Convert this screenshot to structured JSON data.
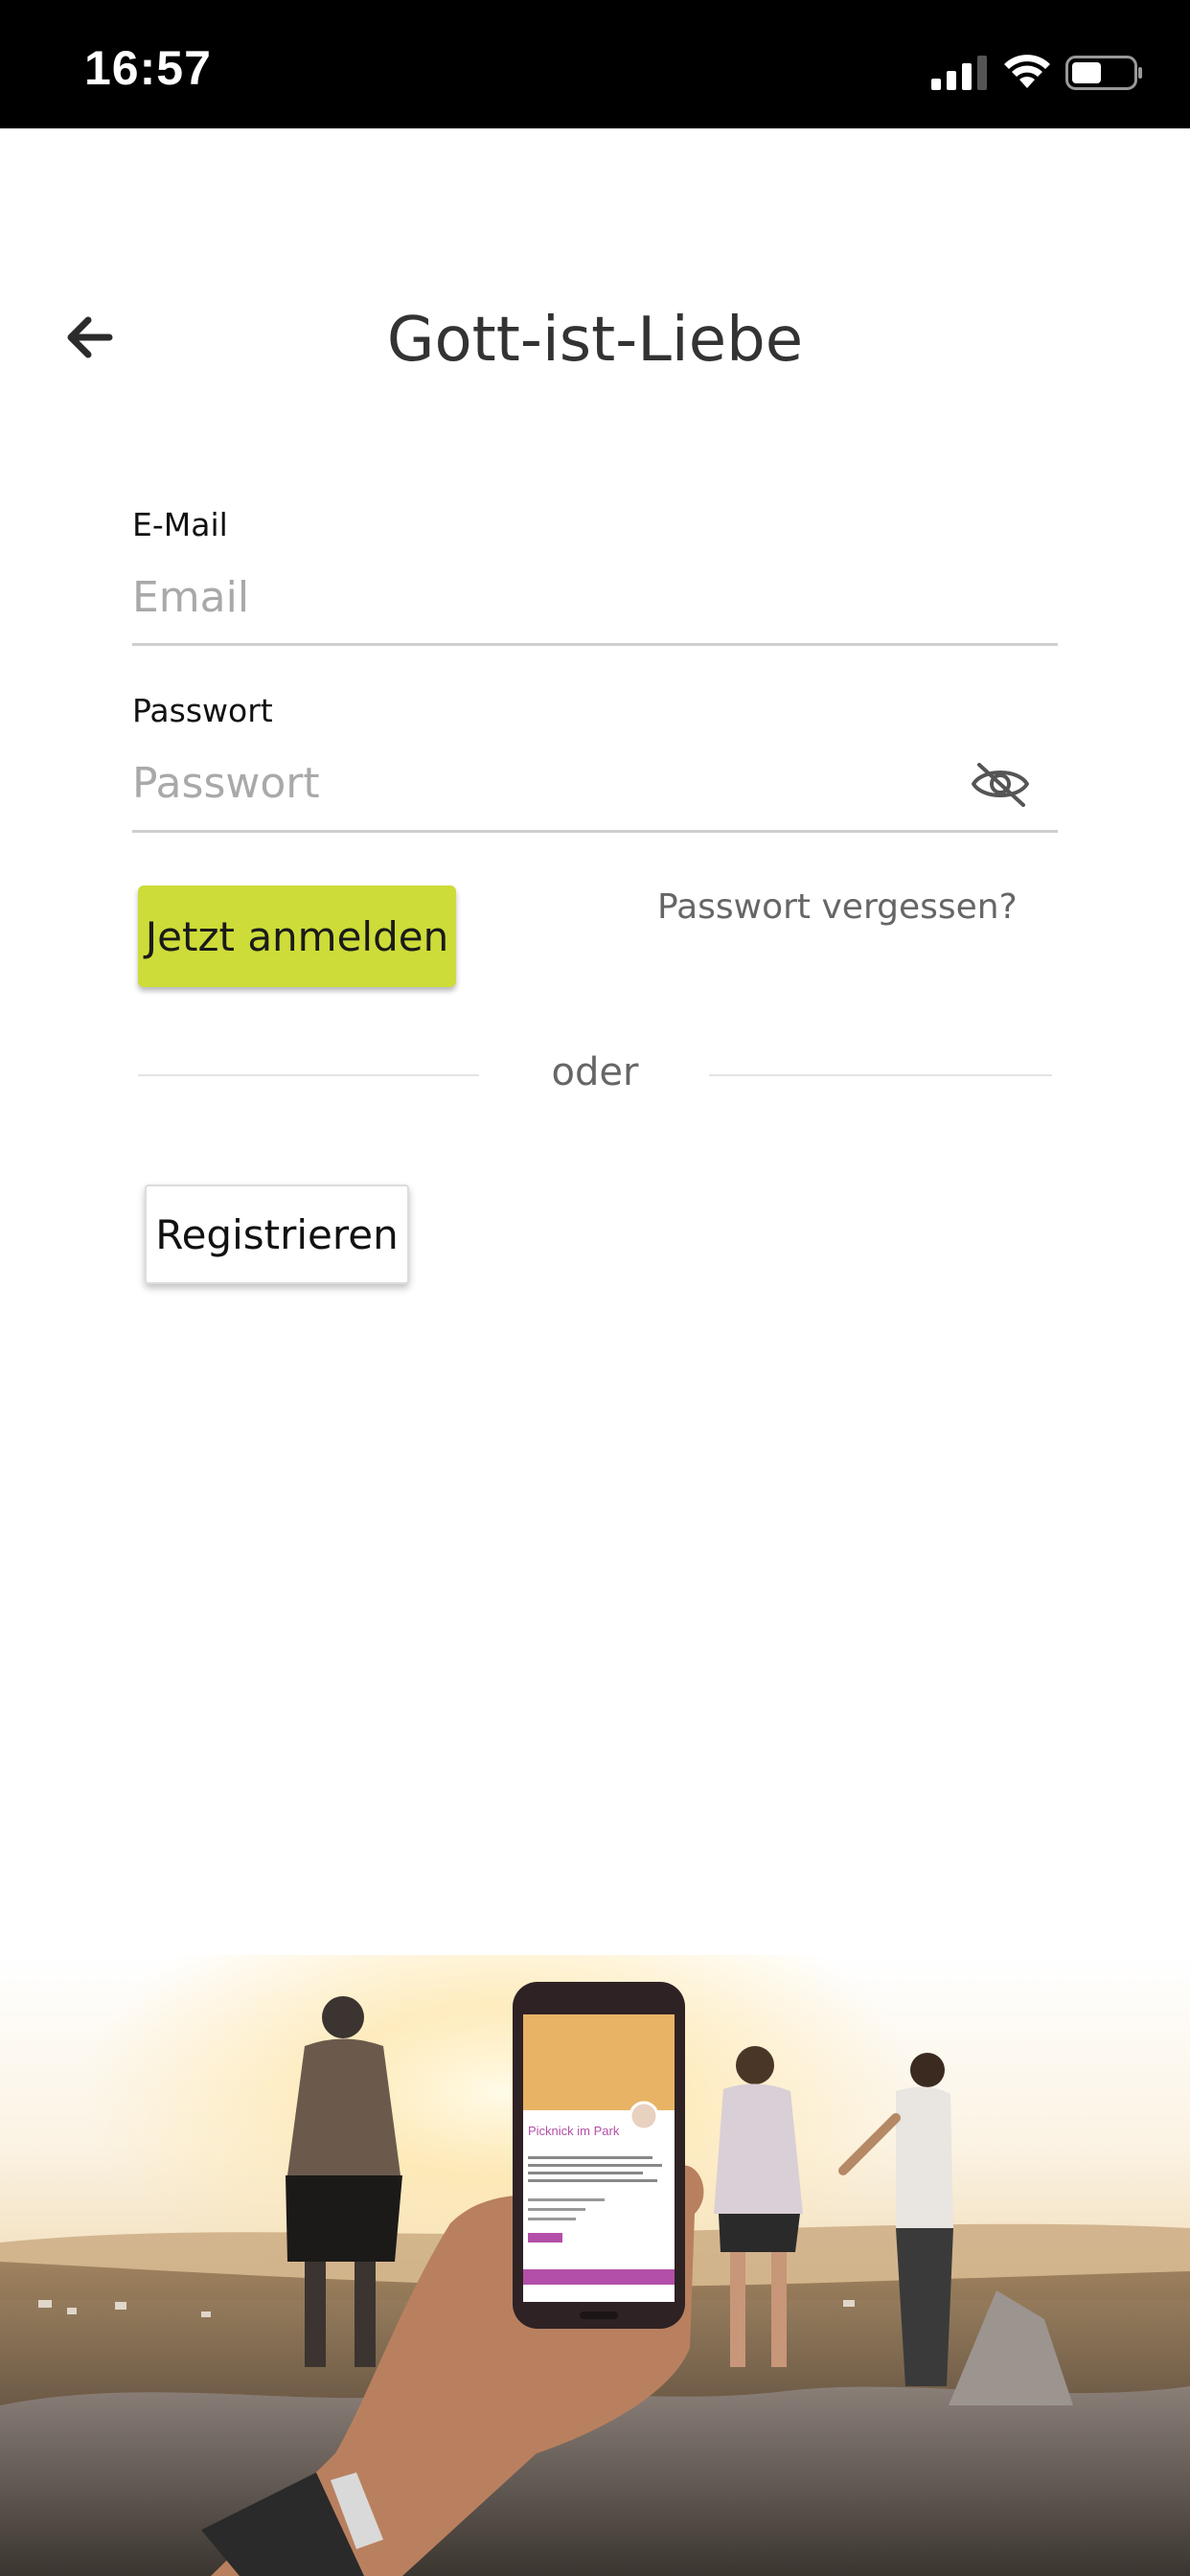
{
  "status_bar": {
    "time": "16:57"
  },
  "header": {
    "title": "Gott-ist-Liebe",
    "back_icon": "arrow-left-icon"
  },
  "form": {
    "email_label": "E-Mail",
    "email_placeholder": "Email",
    "email_value": "",
    "password_label": "Passwort",
    "password_placeholder": "Passwort",
    "password_value": "",
    "password_toggle_icon": "eye-off-icon",
    "login_button": "Jetzt anmelden",
    "forgot_link": "Passwort vergessen?",
    "divider_text": "oder",
    "register_button": "Registrieren"
  },
  "hero": {
    "phone_card_title": "Picknick im Park"
  },
  "colors": {
    "accent": "#cddc39",
    "status_bar": "#000000",
    "phone_accent": "#b34fa8"
  }
}
